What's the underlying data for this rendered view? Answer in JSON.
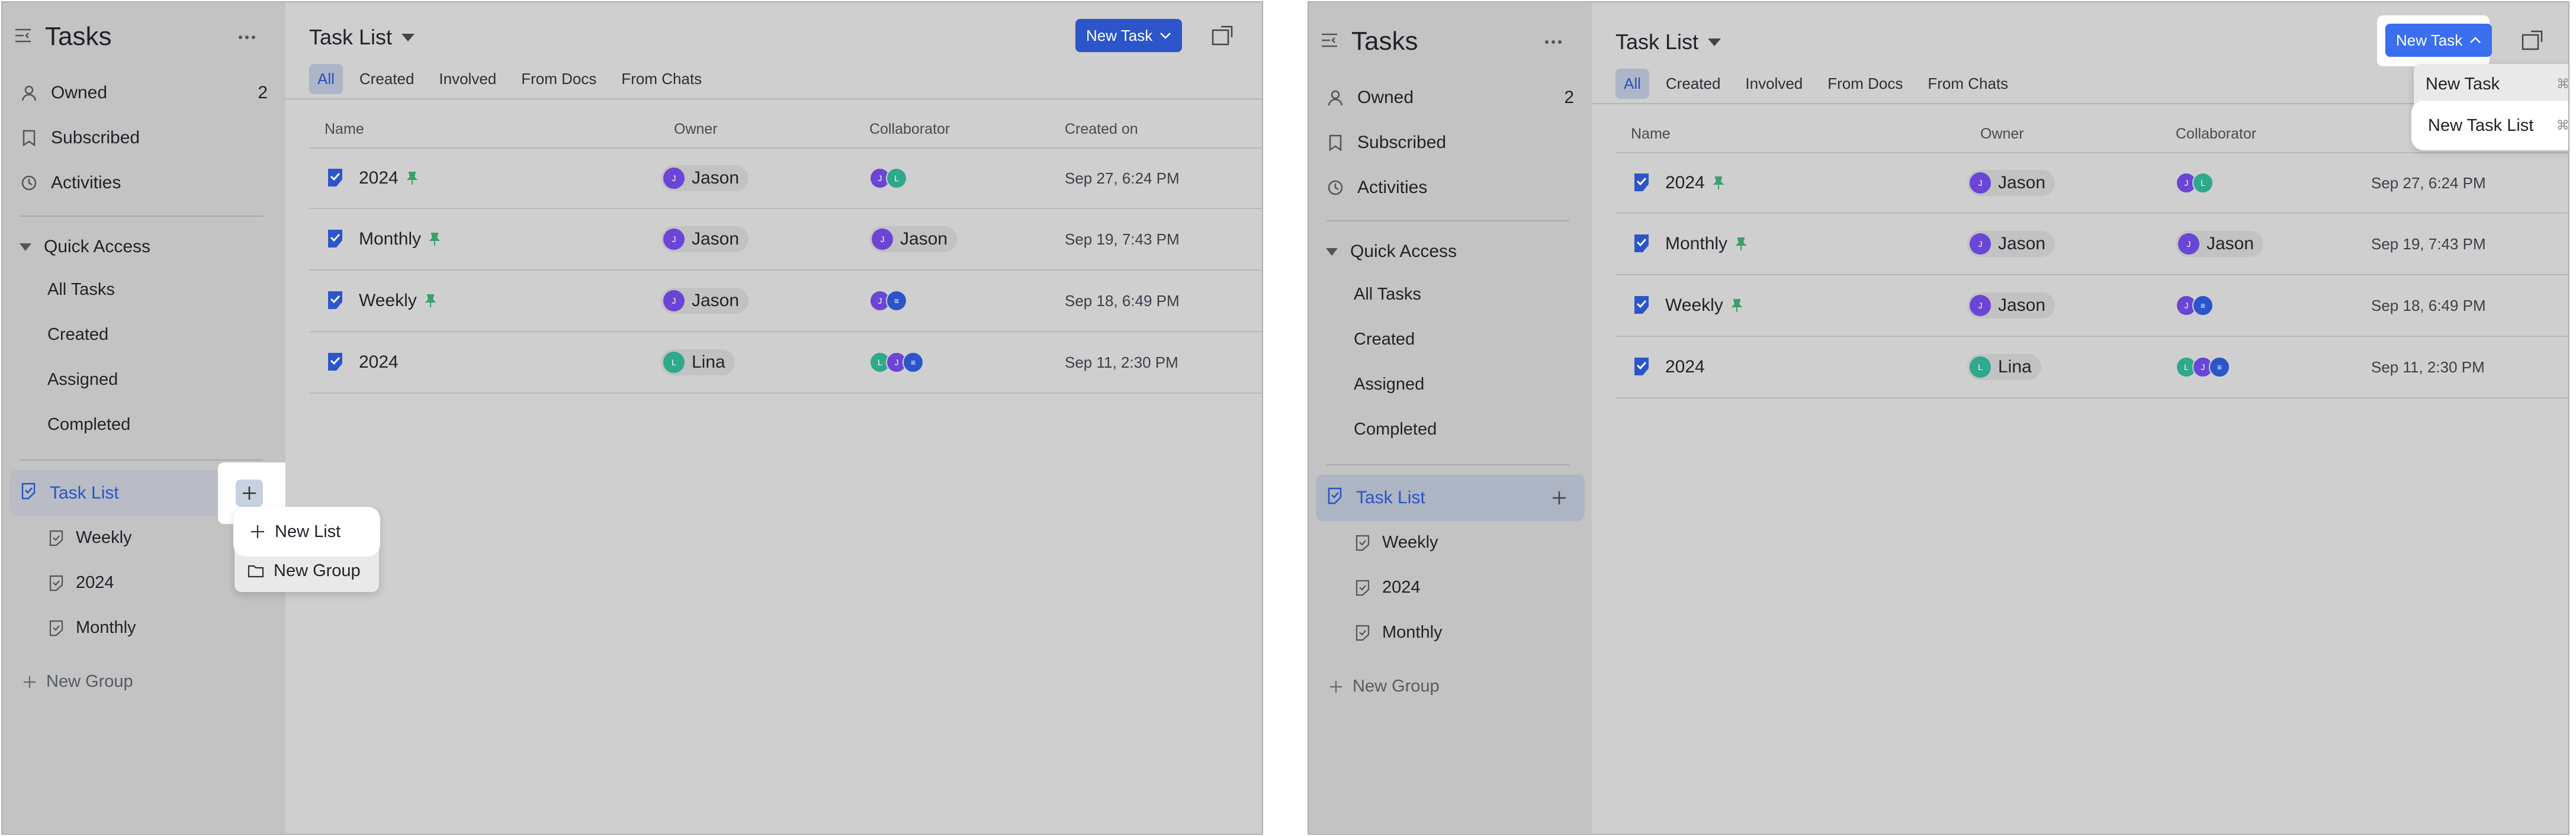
{
  "app": {
    "title": "Tasks"
  },
  "sidebar": {
    "owned": {
      "label": "Owned",
      "count": "2"
    },
    "subscribed": {
      "label": "Subscribed"
    },
    "activities": {
      "label": "Activities"
    },
    "quick_access": {
      "label": "Quick Access",
      "items": [
        {
          "label": "All Tasks"
        },
        {
          "label": "Created"
        },
        {
          "label": "Assigned"
        },
        {
          "label": "Completed"
        }
      ]
    },
    "task_list": {
      "label": "Task List",
      "children": [
        {
          "label": "Weekly"
        },
        {
          "label": "2024"
        },
        {
          "label": "Monthly"
        }
      ]
    },
    "new_group": "New Group"
  },
  "main": {
    "title": "Task List",
    "new_task_label": "New Task",
    "tabs": [
      {
        "label": "All"
      },
      {
        "label": "Created"
      },
      {
        "label": "Involved"
      },
      {
        "label": "From Docs"
      },
      {
        "label": "From Chats"
      }
    ],
    "columns": {
      "name": "Name",
      "owner": "Owner",
      "collaborator": "Collaborator",
      "created_on": "Created on"
    },
    "rows": [
      {
        "name": "2024",
        "pinned": true,
        "owner": "Jason",
        "owner_initial": "J",
        "collab_name": "",
        "created": "Sep 27, 6:24 PM"
      },
      {
        "name": "Monthly",
        "pinned": true,
        "owner": "Jason",
        "owner_initial": "J",
        "collab_name": "Jason",
        "created": "Sep 19, 7:43 PM"
      },
      {
        "name": "Weekly",
        "pinned": true,
        "owner": "Jason",
        "owner_initial": "J",
        "collab_name": "",
        "created": "Sep 18, 6:49 PM"
      },
      {
        "name": "2024",
        "pinned": false,
        "owner": "Lina",
        "owner_initial": "L",
        "collab_name": "",
        "created": "Sep 11, 2:30 PM"
      }
    ]
  },
  "left_popup": {
    "items": [
      {
        "label": "New List"
      },
      {
        "label": "New Group"
      }
    ]
  },
  "right_popup": {
    "items": [
      {
        "label": "New Task",
        "shortcut": "⌘ + N"
      },
      {
        "label": "New Task List",
        "shortcut": "⌘ + L"
      }
    ]
  },
  "colors": {
    "accent": "#2b5fd9",
    "avatar_purple": "#6a45d6",
    "avatar_teal": "#2fa88c",
    "pin_green": "#3aa06b"
  }
}
